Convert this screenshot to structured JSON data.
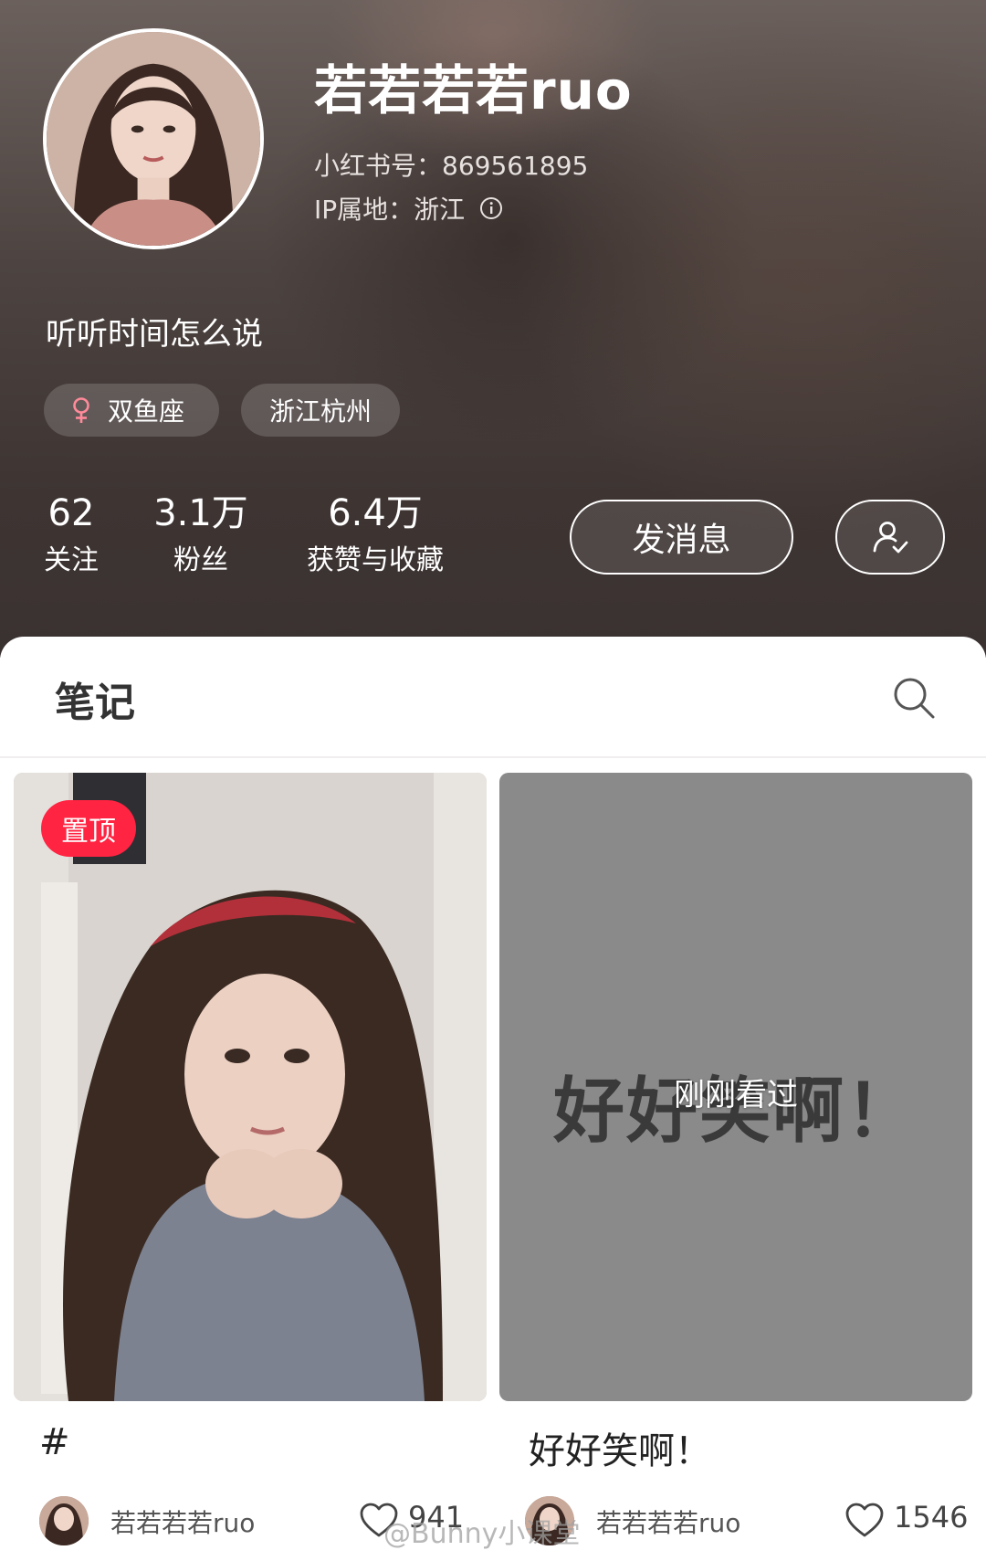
{
  "profile": {
    "nickname": "若若若若ruo",
    "id_text": "小红书号：869561895",
    "ip_text": "IP属地：浙江",
    "bio": "听听时间怎么说",
    "tags": {
      "zodiac": "双鱼座",
      "location": "浙江杭州"
    },
    "stats": {
      "following": {
        "value": "62",
        "label": "关注"
      },
      "fans": {
        "value": "3.1万",
        "label": "粉丝"
      },
      "likes": {
        "value": "6.4万",
        "label": "获赞与收藏"
      }
    },
    "message_button": "发消息",
    "icons": {
      "gender": "female-icon",
      "info": "info-icon",
      "follow": "user-check-icon"
    }
  },
  "tabs": {
    "notes": "笔记",
    "search_icon": "search-icon"
  },
  "notes": [
    {
      "badge": "置顶",
      "title": "#",
      "author": "若若若若ruo",
      "likes": "941",
      "cover_text": "",
      "seen_label": ""
    },
    {
      "badge": "",
      "title": "好好笑啊！",
      "author": "若若若若ruo",
      "likes": "1546",
      "cover_text": "好好笑啊！",
      "seen_label": "刚刚看过"
    }
  ],
  "watermark": "@Bunny小课堂",
  "colors": {
    "accent": "#ff2442",
    "header_bg": "#3e3533",
    "panel_bg": "#ffffff"
  }
}
